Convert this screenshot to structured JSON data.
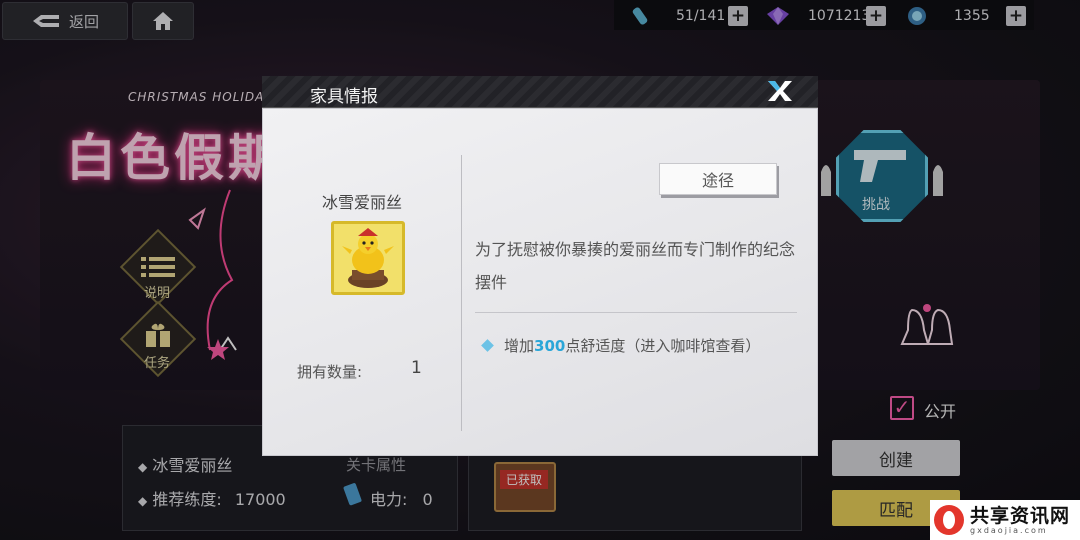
{
  "topbar": {
    "back_label": "返回",
    "resources": [
      {
        "icon": "energy-vial-icon",
        "value": "51/141"
      },
      {
        "icon": "purple-crystal-icon",
        "value": "1071213"
      },
      {
        "icon": "blue-gem-icon",
        "value": "1355"
      }
    ],
    "plus_label": "+"
  },
  "background": {
    "event_subtitle": "CHRISTMAS HOLIDAY",
    "event_title": "白色假期",
    "side_buttons": [
      {
        "icon": "list-icon",
        "label": "说明"
      },
      {
        "icon": "gift-icon",
        "label": "任务"
      }
    ],
    "challenge_label": "挑战",
    "public_label": "公开",
    "create_label": "创建",
    "match_label": "匹配",
    "info": {
      "name": "冰雪爱丽丝",
      "recommended_label": "推荐练度:",
      "recommended_value": "17000",
      "partial_label": "关卡属性",
      "power_label": "电力:",
      "power_value": "0",
      "obtained_badge": "已获取"
    }
  },
  "modal": {
    "title": "家具情报",
    "close_icon": "close-icon",
    "item_name": "冰雪爱丽丝",
    "own_label": "拥有数量:",
    "own_count": "1",
    "route_label": "途径",
    "description": "为了抚慰被你暴揍的爱丽丝而专门制作的纪念摆件",
    "effect_prefix": "增加",
    "effect_value": "300",
    "effect_suffix": "点舒适度（进入咖啡馆查看）"
  },
  "watermark": {
    "title": "共享资讯网",
    "subtitle": "gxdaojia.com"
  },
  "colors": {
    "accent_cyan": "#2aa6d8",
    "neon_pink": "#ff5ea8",
    "gold_button": "#e8cf5a"
  }
}
